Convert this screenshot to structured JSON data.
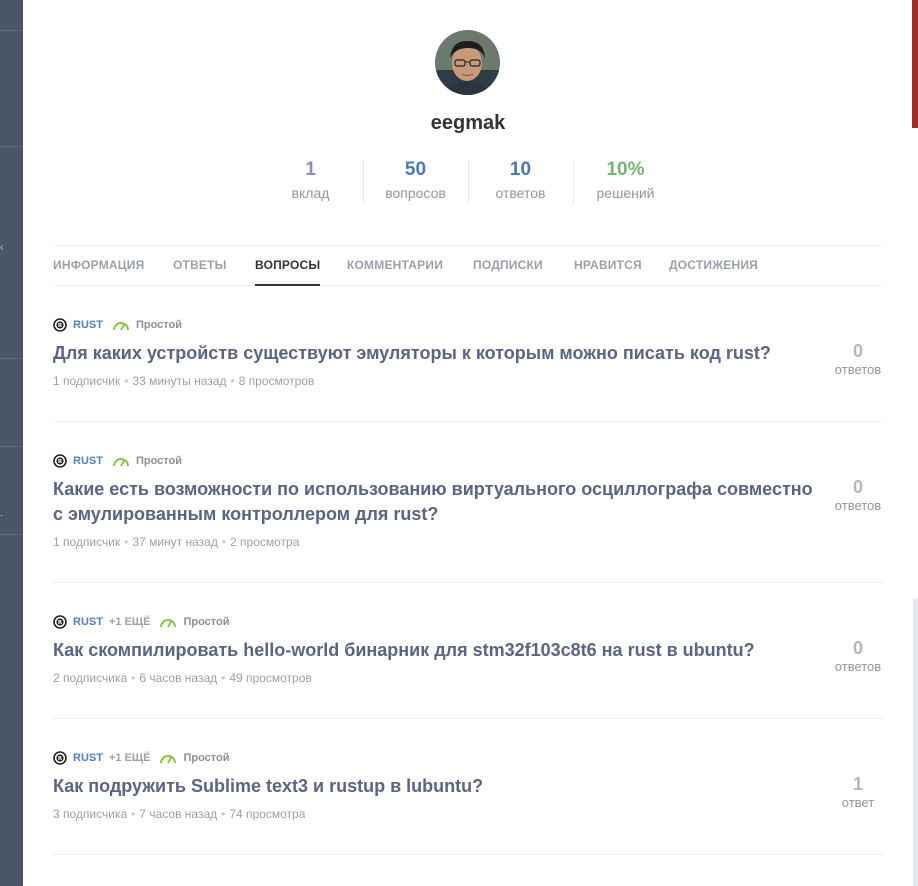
{
  "profile": {
    "username": "eegmak",
    "avatar": "avatar-photo"
  },
  "stats": [
    {
      "value": "1",
      "label": "вклад",
      "color": "#9b85c9"
    },
    {
      "value": "50",
      "label": "вопросов",
      "color": "#4a78b6"
    },
    {
      "value": "10",
      "label": "ответов",
      "color": "#4a78b6"
    },
    {
      "value": "10%",
      "label": "решений",
      "color": "#6fb86f"
    }
  ],
  "tabs": [
    {
      "label": "ИНФОРМАЦИЯ",
      "active": false
    },
    {
      "label": "ОТВЕТЫ",
      "active": false
    },
    {
      "label": "ВОПРОСЫ",
      "active": true
    },
    {
      "label": "КОММЕНТАРИИ",
      "active": false
    },
    {
      "label": "ПОДПИСКИ",
      "active": false
    },
    {
      "label": "НРАВИТСЯ",
      "active": false
    },
    {
      "label": "ДОСТИЖЕНИЯ",
      "active": false
    }
  ],
  "questions": [
    {
      "tag": "RUST",
      "more": "",
      "difficulty": "Простой",
      "title": "Для каких устройств существуют эмуляторы к которым можно писать код rust?",
      "subscribers": "1 подписчик",
      "time": "33 минуты назад",
      "views": "8 просмотров",
      "answers_count": "0",
      "answers_label": "ответов"
    },
    {
      "tag": "RUST",
      "more": "",
      "difficulty": "Простой",
      "title": "Какие есть возможности по использованию виртуального осциллографа совместно с эмулированным контроллером для rust?",
      "subscribers": "1 подписчик",
      "time": "37 минут назад",
      "views": "2 просмотра",
      "answers_count": "0",
      "answers_label": "ответов"
    },
    {
      "tag": "RUST",
      "more": "+1 ЕЩЁ",
      "difficulty": "Простой",
      "title": "Как скомпилировать hello-world бинарник для stm32f103c8t6 на rust в ubuntu?",
      "subscribers": "2 подписчика",
      "time": "6 часов назад",
      "views": "49 просмотров",
      "answers_count": "0",
      "answers_label": "ответов"
    },
    {
      "tag": "RUST",
      "more": "+1 ЕЩЁ",
      "difficulty": "Простой",
      "title": "Как подружить Sublime text3 и rustup в lubuntu?",
      "subscribers": "3 подписчика",
      "time": "7 часов назад",
      "views": "74 просмотра",
      "answers_count": "1",
      "answers_label": "ответ"
    }
  ],
  "icons": {
    "tag": "rust-logo-icon",
    "difficulty": "speedometer-icon"
  },
  "colors": {
    "tag": "#4f7fbf",
    "title": "#5a6585",
    "difficulty": "#8bbf3c",
    "accent": "#a42a2a"
  }
}
